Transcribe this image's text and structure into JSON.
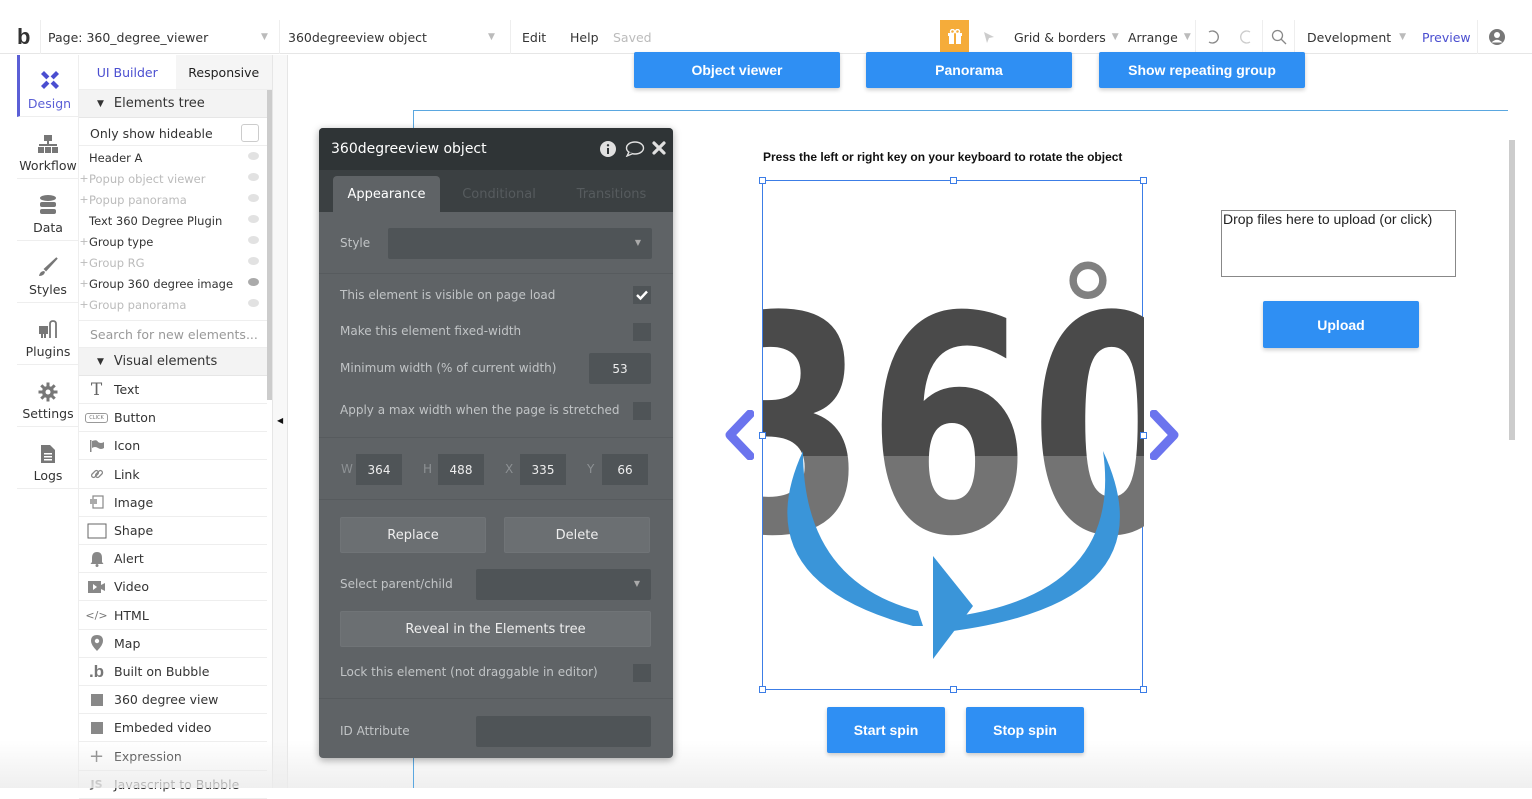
{
  "topbar": {
    "logo": "b",
    "page_label": "Page: 360_degree_viewer",
    "element_selector": "360degreeview object",
    "menu_edit": "Edit",
    "menu_help": "Help",
    "save_status": "Saved",
    "grid_borders": "Grid & borders",
    "arrange": "Arrange",
    "environment": "Development",
    "preview": "Preview"
  },
  "leftnav": {
    "items": [
      {
        "label": "Design",
        "icon": "design-icon",
        "active": true
      },
      {
        "label": "Workflow",
        "icon": "workflow-icon"
      },
      {
        "label": "Data",
        "icon": "database-icon"
      },
      {
        "label": "Styles",
        "icon": "brush-icon"
      },
      {
        "label": "Plugins",
        "icon": "plug-icon"
      },
      {
        "label": "Settings",
        "icon": "gear-icon"
      },
      {
        "label": "Logs",
        "icon": "document-icon"
      }
    ]
  },
  "panel": {
    "tabs": [
      "UI Builder",
      "Responsive"
    ],
    "elements_tree_title": "Elements tree",
    "only_show_hideable": "Only show hideable",
    "tree": [
      {
        "label": "Header A",
        "expandable": false,
        "dim": false,
        "eye": "visible"
      },
      {
        "label": "Popup object viewer",
        "expandable": true,
        "dim": true,
        "eye": "hidden"
      },
      {
        "label": "Popup panorama",
        "expandable": true,
        "dim": true,
        "eye": "hidden"
      },
      {
        "label": "Text 360 Degree Plugin",
        "expandable": false,
        "dim": false,
        "eye": "visible"
      },
      {
        "label": "Group type",
        "expandable": true,
        "dim": false,
        "eye": "visible"
      },
      {
        "label": "Group RG",
        "expandable": true,
        "dim": true,
        "eye": "hidden"
      },
      {
        "label": "Group 360 degree image",
        "expandable": true,
        "dim": false,
        "eye": "visible-dark"
      },
      {
        "label": "Group panorama",
        "expandable": true,
        "dim": true,
        "eye": "hidden"
      }
    ],
    "search_placeholder": "Search for new elements...",
    "visual_elements_title": "Visual elements",
    "visual_elements": [
      {
        "label": "Text",
        "icon": "text-icon"
      },
      {
        "label": "Button",
        "icon": "button-icon"
      },
      {
        "label": "Icon",
        "icon": "flag-icon"
      },
      {
        "label": "Link",
        "icon": "link-icon"
      },
      {
        "label": "Image",
        "icon": "image-icon"
      },
      {
        "label": "Shape",
        "icon": "shape-icon"
      },
      {
        "label": "Alert",
        "icon": "bell-icon"
      },
      {
        "label": "Video",
        "icon": "video-icon"
      },
      {
        "label": "HTML",
        "icon": "code-icon"
      },
      {
        "label": "Map",
        "icon": "map-pin-icon"
      },
      {
        "label": "Built on Bubble",
        "icon": "bubble-logo-icon"
      },
      {
        "label": "360 degree view",
        "icon": "plugin-square-icon"
      },
      {
        "label": "Embeded video",
        "icon": "plugin-square-icon"
      },
      {
        "label": "Expression",
        "icon": "plus-icon"
      },
      {
        "label": "Javascript to Bubble",
        "icon": "js-icon"
      }
    ],
    "button_icon_text": "CLICK"
  },
  "canvas": {
    "nav_buttons": [
      "Object viewer",
      "Panorama",
      "Show repeating group"
    ],
    "instruction": "Press the left or right key on your keyboard to rotate the object",
    "image_text": "360",
    "image_degree": "°",
    "dropzone_text": "Drop files here to upload (or click)",
    "upload_button": "Upload",
    "start_spin": "Start spin",
    "stop_spin": "Stop spin",
    "colors": {
      "button_blue": "#2f8ff3",
      "arrow_purple": "#6b74ee",
      "selection_blue": "#3c7de6",
      "ring_blue": "#3a95d9"
    }
  },
  "editor": {
    "title": "360degreeview object",
    "tabs": [
      "Appearance",
      "Conditional",
      "Transitions"
    ],
    "style_label": "Style",
    "visible_on_load": {
      "label": "This element is visible on page load",
      "checked": true
    },
    "fixed_width": {
      "label": "Make this element fixed-width",
      "checked": false
    },
    "min_width": {
      "label": "Minimum width (% of current width)",
      "value": "53"
    },
    "max_width": {
      "label": "Apply a max width when the page is stretched",
      "checked": false
    },
    "dims": [
      {
        "label": "W",
        "value": "364"
      },
      {
        "label": "H",
        "value": "488"
      },
      {
        "label": "X",
        "value": "335"
      },
      {
        "label": "Y",
        "value": "66"
      }
    ],
    "replace": "Replace",
    "delete": "Delete",
    "select_parent_child": "Select parent/child",
    "reveal": "Reveal in the Elements tree",
    "lock": {
      "label": "Lock this element (not draggable in editor)",
      "checked": false
    },
    "id_attribute": "ID Attribute"
  }
}
